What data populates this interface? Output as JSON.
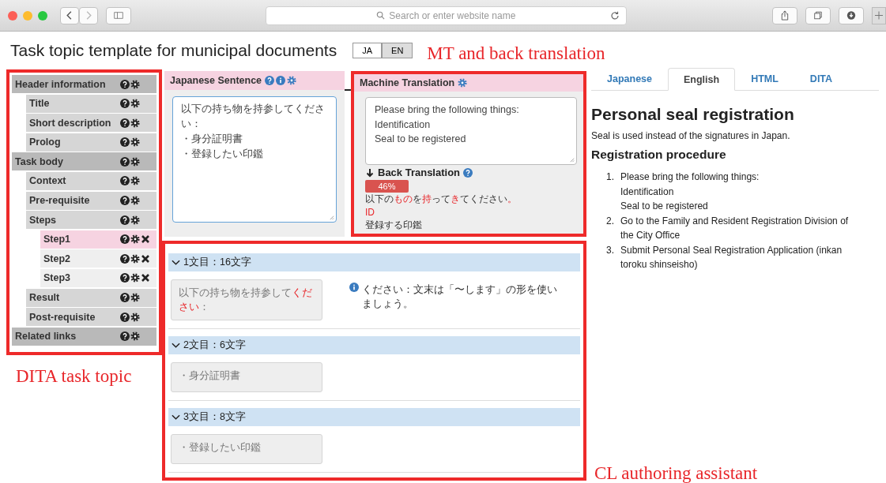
{
  "browser": {
    "address_placeholder": "Search or enter website name"
  },
  "page": {
    "title": "Task topic template for municipal documents",
    "lang_toggle": [
      {
        "label": "JA",
        "selected": false
      },
      {
        "label": "EN",
        "selected": true
      }
    ]
  },
  "annotations": {
    "sidebar": "DITA task topic",
    "mt": "MT and back translation",
    "cl": "CL authoring assistant"
  },
  "sidebar": {
    "items": [
      {
        "label": "Header information",
        "selected": false,
        "removable": false,
        "children": [
          {
            "label": "Title",
            "selected": false,
            "removable": false
          },
          {
            "label": "Short description",
            "selected": false,
            "removable": false
          },
          {
            "label": "Prolog",
            "selected": false,
            "removable": false
          }
        ]
      },
      {
        "label": "Task body",
        "selected": false,
        "removable": false,
        "children": [
          {
            "label": "Context",
            "selected": false,
            "removable": false
          },
          {
            "label": "Pre-requisite",
            "selected": false,
            "removable": false
          },
          {
            "label": "Steps",
            "selected": false,
            "removable": false,
            "children": [
              {
                "label": "Step1",
                "selected": true,
                "removable": true
              },
              {
                "label": "Step2",
                "selected": false,
                "removable": true
              },
              {
                "label": "Step3",
                "selected": false,
                "removable": true
              }
            ]
          },
          {
            "label": "Result",
            "selected": false,
            "removable": false
          },
          {
            "label": "Post-requisite",
            "selected": false,
            "removable": false
          }
        ]
      },
      {
        "label": "Related links",
        "selected": false,
        "removable": false
      }
    ]
  },
  "japanese_panel": {
    "title": "Japanese Sentence",
    "lines": [
      "以下の持ち物を持参してください：",
      "・身分証明書",
      "・登録したい印鑑"
    ]
  },
  "mt_panel": {
    "title": "Machine Translation",
    "text": "Please bring the following things:\nIdentification\nSeal to be registered",
    "back_translation": {
      "title": "Back Translation",
      "score": "46%",
      "lines": [
        [
          {
            "text": "以下の",
            "flagged": false
          },
          {
            "text": "もの",
            "flagged": true
          },
          {
            "text": "を",
            "flagged": false
          },
          {
            "text": "持",
            "flagged": true
          },
          {
            "text": "って",
            "flagged": false
          },
          {
            "text": "き",
            "flagged": true
          },
          {
            "text": "てください",
            "flagged": false
          },
          {
            "text": "。",
            "flagged": true
          }
        ],
        [
          {
            "text": "ID",
            "flagged": true
          }
        ],
        [
          {
            "text": "登録する印鑑",
            "flagged": false
          }
        ]
      ]
    }
  },
  "cl_assistant": {
    "sentences": [
      {
        "heading": "1文目：16文字",
        "expanded": true,
        "segments": [
          {
            "text": "以下の持ち物を持参して",
            "flagged": false
          },
          {
            "text": "ください",
            "flagged": true
          },
          {
            "text": "：",
            "flagged": false
          }
        ],
        "advice": "ください：文末は「〜します」の形を使いましょう。"
      },
      {
        "heading": "2文目：6文字",
        "expanded": true,
        "segments": [
          {
            "text": "・身分証明書",
            "flagged": false
          }
        ]
      },
      {
        "heading": "3文目：8文字",
        "expanded": true,
        "segments": [
          {
            "text": "・登録したい印鑑",
            "flagged": false
          }
        ]
      }
    ]
  },
  "preview": {
    "tabs": [
      {
        "label": "Japanese",
        "selected": false
      },
      {
        "label": "English",
        "selected": true
      },
      {
        "label": "HTML",
        "selected": false
      },
      {
        "label": "DITA",
        "selected": false
      }
    ],
    "heading": "Personal seal registration",
    "paragraph": "Seal is used instead of the signatures in Japan.",
    "subheading": "Registration procedure",
    "steps": [
      {
        "number": "1.",
        "lines": [
          "Please bring the following things:",
          "Identification",
          "Seal to be registered"
        ]
      },
      {
        "number": "2.",
        "lines": [
          "Go to the Family and Resident Registration Division of the City Office"
        ]
      },
      {
        "number": "3.",
        "lines": [
          "Submit Personal Seal Registration Application (inkan toroku shinseisho)"
        ]
      }
    ]
  }
}
